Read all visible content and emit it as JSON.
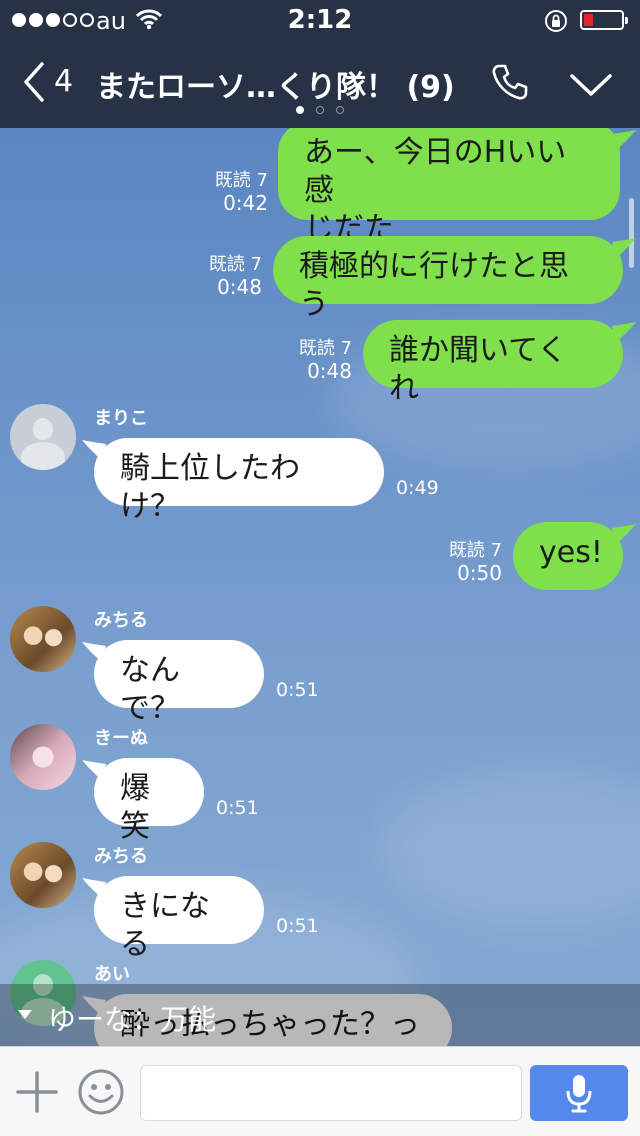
{
  "status": {
    "carrier": "au",
    "time": "2:12"
  },
  "header": {
    "back_count": "4",
    "title": "またローソ…くり隊！ (9)"
  },
  "messages": [
    {
      "text1": "あー、今日のHいい感",
      "text2": "じだた",
      "read": "既読 7",
      "time": "0:42"
    },
    {
      "text": "積極的に行けたと思う",
      "read": "既読 7",
      "time": "0:48"
    },
    {
      "text": "誰か聞いてくれ",
      "read": "既読 7",
      "time": "0:48"
    },
    {
      "sender": "まりこ",
      "text": "騎上位したわけ？",
      "time": "0:49"
    },
    {
      "text": "yes!",
      "read": "既読 7",
      "time": "0:50"
    },
    {
      "sender": "みちる",
      "text": "なんで？",
      "time": "0:51"
    },
    {
      "sender": "きーぬ",
      "text": "爆笑",
      "time": "0:51"
    },
    {
      "sender": "みちる",
      "text": "きになる",
      "time": "0:51"
    },
    {
      "sender": "あい",
      "text": "酔っ払っちゃった？っ"
    }
  ],
  "notice": {
    "text": "ゆーな：万能"
  },
  "input": {
    "placeholder": ""
  },
  "colors": {
    "header_bg": "#273246",
    "my_bubble": "#7fe04c",
    "their_bubble": "#ffffff",
    "send_button": "#5488ec"
  }
}
